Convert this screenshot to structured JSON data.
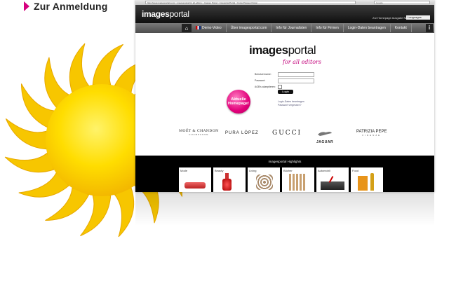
{
  "top_link": {
    "label": "Zur Anmeldung"
  },
  "browser": {
    "url": "http://www.imagesportal.com/ :: imagesportal for all editors :: Images Portal :: Fotoportal Portal :: Fotos Pressen Portal",
    "search_placeholder": "Google"
  },
  "site": {
    "logo_bold": "images",
    "logo_light": "portal",
    "issue_text": "Zur Homepage Ausgabe Nr.: 15 |",
    "language_label": "Languages"
  },
  "nav": {
    "items": [
      "Demo-Video",
      "Über imagesportal.com",
      "Info für Journalisten",
      "Info für Firmen",
      "Login-Daten beantragen",
      "Kontakt"
    ],
    "info_label": "i"
  },
  "content": {
    "logo_bold": "images",
    "logo_light": "portal",
    "tagline": "for all editors",
    "username_label": "Benutzername:",
    "password_label": "Passwort:",
    "agb_label": "AGB's akzeptieren:",
    "login_button": "Login",
    "link_register": "Login-Daten beantragen",
    "link_forgot": "Passwort vergessen?",
    "badge": "Aktuelle Homepage!"
  },
  "brands": [
    "MOËT & CHANDON",
    "PURA LÓPEZ",
    "GUCCI",
    "JAGUAR",
    "PATRIZIA PEPE"
  ],
  "brand_sub": {
    "moet": "CHAMPAGNE",
    "patrizia": "FIRENZE"
  },
  "highlights": {
    "title": "imagesportal Highlights",
    "categories": [
      "Mode",
      "Beauty",
      "Living",
      "Bücher",
      "Automobil",
      "Food"
    ]
  },
  "colors": {
    "accent": "#d6007e",
    "sun": "#ffd400",
    "sun_ray": "#f5c400"
  }
}
